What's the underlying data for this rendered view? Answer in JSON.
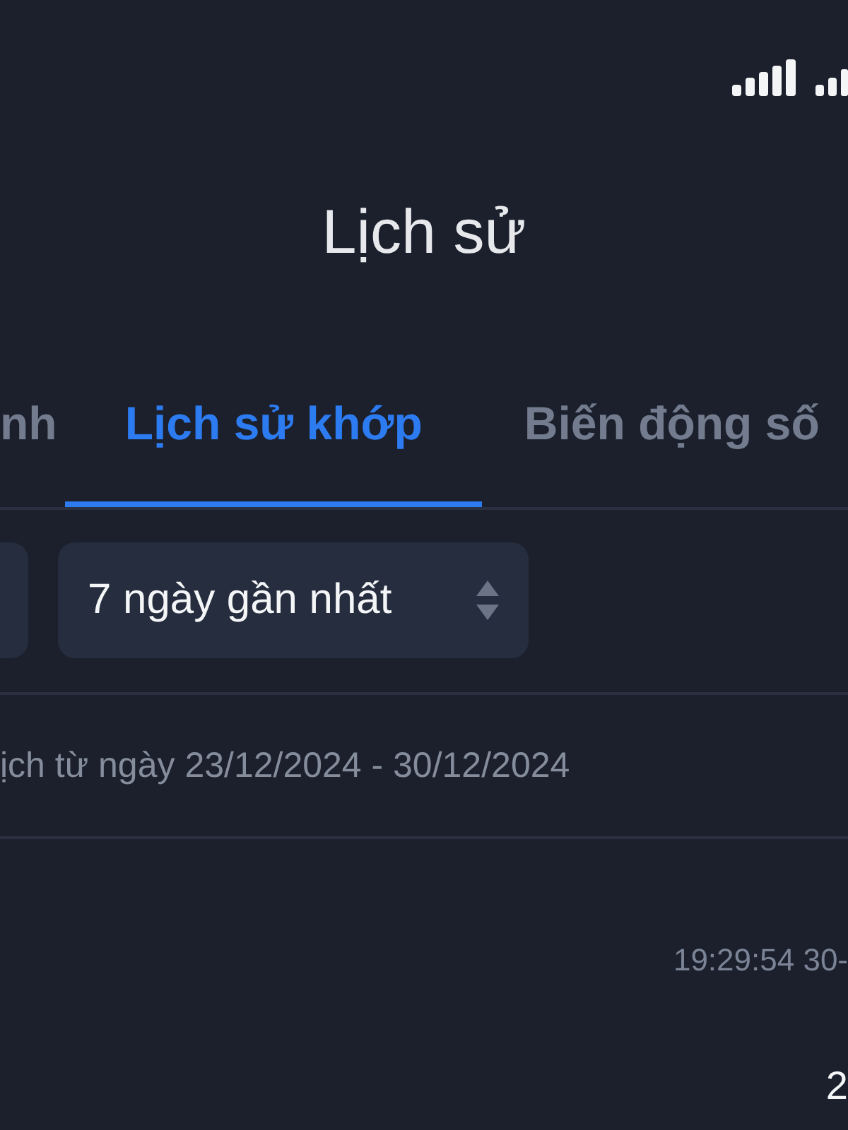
{
  "header": {
    "title": "Lịch sử"
  },
  "tabs": [
    {
      "label": "nh",
      "selected": false
    },
    {
      "label": "Lịch sử khớp",
      "selected": true
    },
    {
      "label": "Biến động số",
      "selected": false
    }
  ],
  "filters": {
    "period": {
      "value": "7 ngày gần nhất"
    }
  },
  "range_text": "ịch từ ngày 23/12/2024 - 30/12/2024",
  "entries": [
    {
      "timestamp": "19:29:54 30-",
      "column_2": "2"
    }
  ]
}
